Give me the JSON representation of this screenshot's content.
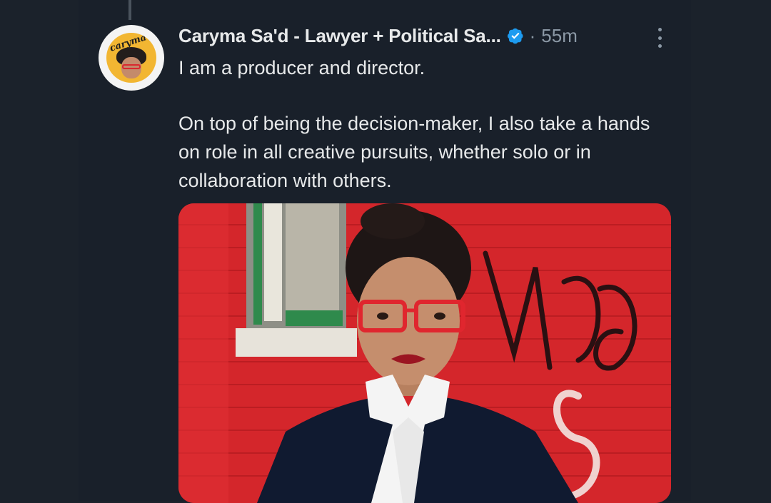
{
  "tweet": {
    "display_name": "Caryma Sa'd - Lawyer + Political Sa...",
    "separator": "·",
    "time_ago": "55m",
    "paragraphs": [
      "I am a producer and director.",
      "On top of being the decision-maker, I also take a hands on role in all creative pursuits, whether solo or in collaboration with others."
    ],
    "verified": true,
    "avatar_text": "caryma"
  },
  "colors": {
    "background": "#19202a",
    "text": "#e7e9ea",
    "muted": "#8b98a5",
    "verified": "#1d9bf0"
  },
  "icons": {
    "verified": "verified-badge-icon",
    "more": "more-options-icon"
  }
}
